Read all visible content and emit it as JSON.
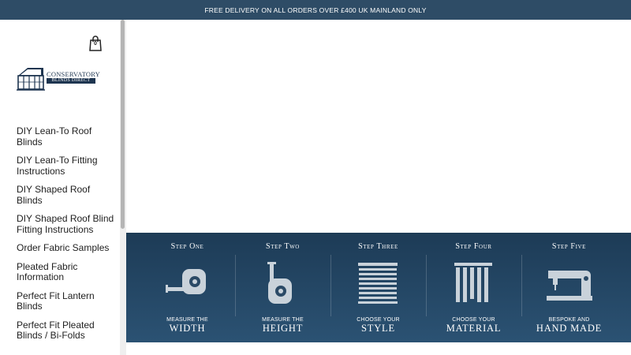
{
  "announcement": "FREE DELIVERY ON ALL ORDERS OVER £400 UK MAINLAND ONLY",
  "cart": {
    "icon": "shopping-bag-icon",
    "count": "0"
  },
  "logo": {
    "line1": "CONSERVATORY",
    "line2": "BLINDS DIRECT"
  },
  "nav": [
    "DIY Lean-To Roof Blinds",
    "DIY Lean-To Fitting Instructions",
    "DIY Shaped Roof Blinds",
    "DIY Shaped Roof Blind Fitting Instructions",
    "Order Fabric Samples",
    "Pleated Fabric Information",
    "Perfect Fit Lantern Blinds",
    "Perfect Fit Pleated Blinds / Bi-Folds"
  ],
  "steps": [
    {
      "title": "Step One",
      "caption1": "MEASURE THE",
      "caption2": "WIDTH",
      "icon": "tape-measure-icon"
    },
    {
      "title": "Step Two",
      "caption1": "MEASURE THE",
      "caption2": "HEIGHT",
      "icon": "tape-measure-vertical-icon"
    },
    {
      "title": "Step Three",
      "caption1": "CHOOSE YOUR",
      "caption2": "STYLE",
      "icon": "venetian-blind-icon"
    },
    {
      "title": "Step Four",
      "caption1": "CHOOSE YOUR",
      "caption2": "MATERIAL",
      "icon": "vertical-blind-icon"
    },
    {
      "title": "Step Five",
      "caption1": "BESPOKE AND",
      "caption2": "HAND MADE",
      "icon": "sewing-machine-icon"
    }
  ],
  "colors": {
    "topbar": "#2e4c66",
    "banner": "#1d3b56",
    "icon": "#c9d2da"
  }
}
